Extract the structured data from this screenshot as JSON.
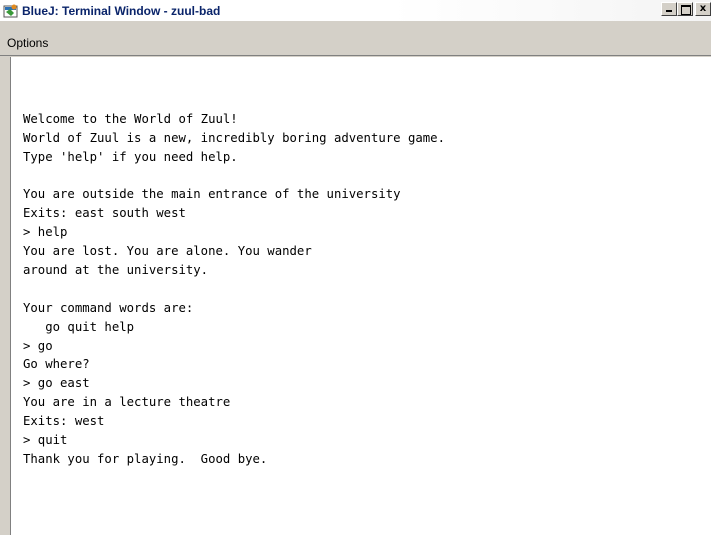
{
  "window": {
    "title": "BlueJ: Terminal Window - zuul-bad",
    "icon": "bluej-app-icon",
    "buttons": [
      "minimize-icon",
      "maximize-icon",
      "close-icon"
    ],
    "close_label": "x"
  },
  "menubar": {
    "items": [
      "Options"
    ]
  },
  "terminal": {
    "lines": [
      "",
      "Welcome to the World of Zuul!",
      "World of Zuul is a new, incredibly boring adventure game.",
      "Type 'help' if you need help.",
      "",
      "You are outside the main entrance of the university",
      "Exits: east south west",
      "> help",
      "You are lost. You are alone. You wander",
      "around at the university.",
      "",
      "Your command words are:",
      "   go quit help",
      "> go",
      "Go where?",
      "> go east",
      "You are in a lecture theatre",
      "Exits: west",
      "> quit",
      "Thank you for playing.  Good bye."
    ]
  },
  "colors": {
    "title_text": "#0a246a",
    "chrome": "#d4d0c8",
    "terminal_bg": "#ffffff"
  }
}
